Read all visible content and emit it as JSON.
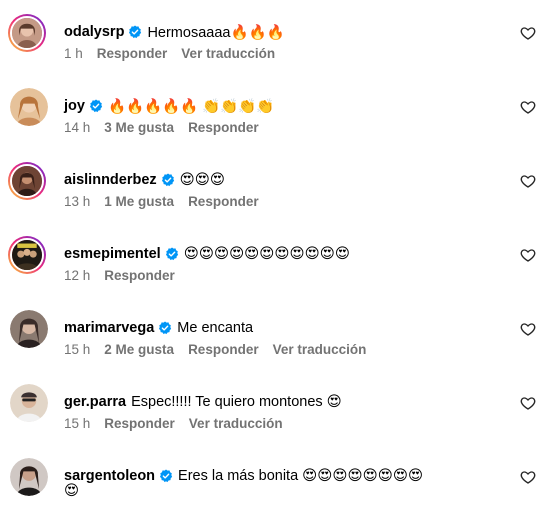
{
  "comments": [
    {
      "username": "odalysrp",
      "verified": true,
      "text": "Hermosaaaa🔥🔥🔥",
      "time": "1 h",
      "likes": "",
      "reply_label": "Responder",
      "translate_label": "Ver traducción",
      "avatar_color": "#b08a78"
    },
    {
      "username": "joy",
      "verified": true,
      "text": "🔥🔥🔥🔥🔥 👏👏👏👏",
      "time": "14 h",
      "likes": "3 Me gusta",
      "reply_label": "Responder",
      "translate_label": "",
      "avatar_color": "#d9a373"
    },
    {
      "username": "aislinnderbez",
      "verified": true,
      "text": "😍😍😍",
      "time": "13 h",
      "likes": "1 Me gusta",
      "reply_label": "Responder",
      "translate_label": "",
      "avatar_color": "#7a4a3a"
    },
    {
      "username": "esmepimentel",
      "verified": true,
      "text": "😍😍😍😍😍😍😍😍😍😍😍",
      "time": "12 h",
      "likes": "",
      "reply_label": "Responder",
      "translate_label": "",
      "avatar_color": "#3a3226"
    },
    {
      "username": "marimarvega",
      "verified": true,
      "text": "Me encanta",
      "time": "15 h",
      "likes": "2 Me gusta",
      "reply_label": "Responder",
      "translate_label": "Ver traducción",
      "avatar_color": "#4a3a34"
    },
    {
      "username": "ger.parra",
      "verified": false,
      "text": "Espec!!!!! Te quiero montones 😍",
      "time": "15 h",
      "likes": "",
      "reply_label": "Responder",
      "translate_label": "Ver traducción",
      "avatar_color": "#c9b8a8"
    },
    {
      "username": "sargentoleon",
      "verified": true,
      "text": "Eres la más bonita 😍😍😍😍😍😍😍😍",
      "text_cont": "😍",
      "time": "",
      "likes": "",
      "reply_label": "",
      "translate_label": "",
      "avatar_color": "#5a4a44"
    }
  ],
  "colors": {
    "verified": "#0095f6",
    "secondary_text": "#737373",
    "story_ring_start": "#f9ce34",
    "story_ring_mid": "#ee2a7b",
    "story_ring_end": "#6228d7"
  },
  "icons": {
    "verified": "verified-badge-icon",
    "like": "heart-outline-icon"
  }
}
